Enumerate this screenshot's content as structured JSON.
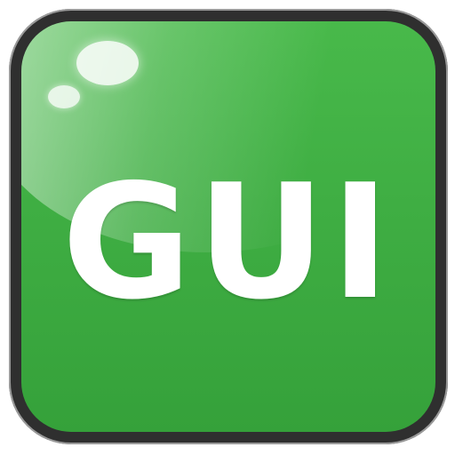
{
  "app_icon": {
    "label": "GUI",
    "colors": {
      "face_top": "#48b94a",
      "face_bottom": "#35a13a",
      "border": "#2f2f2f",
      "label": "#ffffff"
    }
  }
}
